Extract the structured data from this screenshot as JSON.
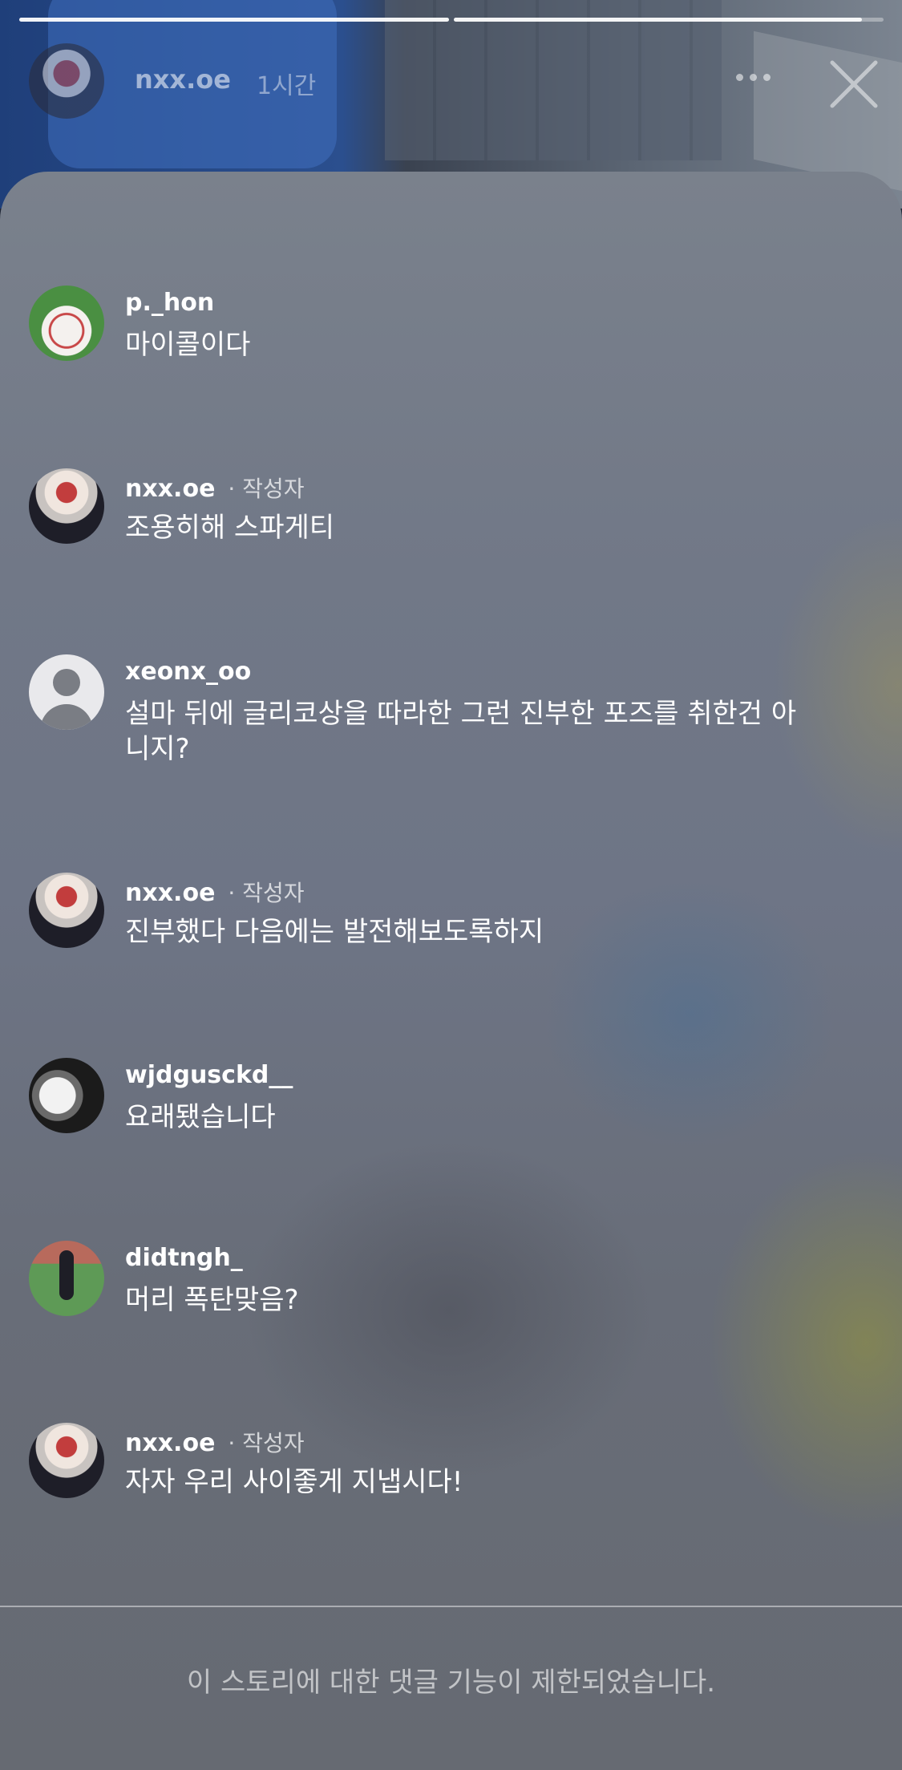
{
  "story": {
    "username": "nxx.oe",
    "time": "1시간",
    "progress": [
      1.0,
      0.95
    ]
  },
  "comments": [
    {
      "username": "p._hon",
      "tag": "",
      "text": "마이콜이다"
    },
    {
      "username": "nxx.oe",
      "tag": "· 작성자",
      "text": "조용히해 스파게티"
    },
    {
      "username": "xeonx_oo",
      "tag": "",
      "text": "설마 뒤에 글리코상을 따라한 그런 진부한 포즈를 취한건 아니지?"
    },
    {
      "username": "nxx.oe",
      "tag": "· 작성자",
      "text": "진부했다 다음에는 발전해보도록하지"
    },
    {
      "username": "wjdgusckd__",
      "tag": "",
      "text": "요래됐습니다"
    },
    {
      "username": "didtngh_",
      "tag": "",
      "text": "머리 폭탄맞음?"
    },
    {
      "username": "nxx.oe",
      "tag": "· 작성자",
      "text": "자자 우리 사이좋게 지냅시다!"
    }
  ],
  "footer": {
    "restricted_notice": "이 스토리에 대한 댓글 기능이 제한되었습니다."
  }
}
